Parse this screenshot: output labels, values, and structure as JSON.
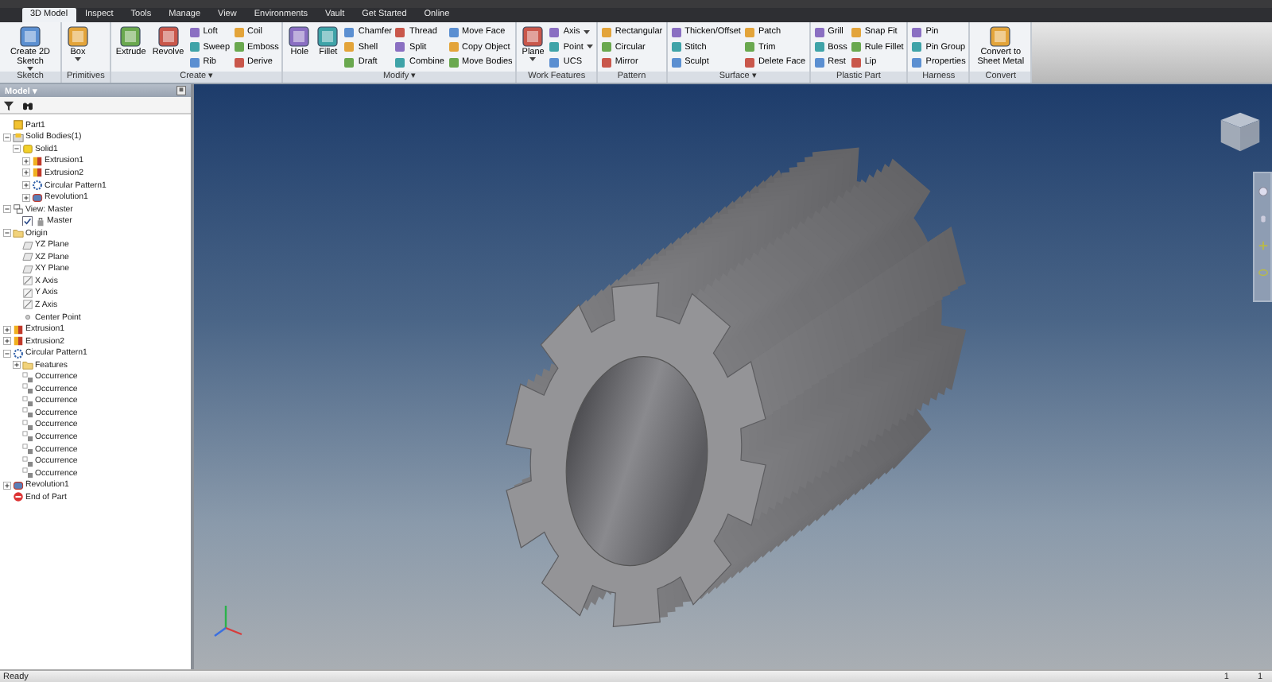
{
  "tabs": [
    {
      "label": "3D Model",
      "selected": true
    },
    {
      "label": "Inspect",
      "selected": false
    },
    {
      "label": "Tools",
      "selected": false
    },
    {
      "label": "Manage",
      "selected": false
    },
    {
      "label": "View",
      "selected": false
    },
    {
      "label": "Environments",
      "selected": false
    },
    {
      "label": "Vault",
      "selected": false
    },
    {
      "label": "Get Started",
      "selected": false
    },
    {
      "label": "Online",
      "selected": false
    }
  ],
  "ribbon": [
    {
      "title": "Sketch",
      "columns": [
        {
          "kind": "large",
          "items": [
            {
              "label": "Create 2D Sketch",
              "menu": true
            }
          ]
        }
      ]
    },
    {
      "title": "Primitives",
      "columns": [
        {
          "kind": "large",
          "items": [
            {
              "label": "Box",
              "menu": true
            }
          ]
        }
      ]
    },
    {
      "title": "Create ▾",
      "columns": [
        {
          "kind": "large",
          "items": [
            {
              "label": "Extrude",
              "menu": false
            }
          ]
        },
        {
          "kind": "large",
          "items": [
            {
              "label": "Revolve",
              "menu": false
            }
          ]
        },
        {
          "kind": "small",
          "items": [
            {
              "label": "Loft",
              "menu": false
            },
            {
              "label": "Sweep",
              "menu": false
            },
            {
              "label": "Rib",
              "menu": false
            }
          ]
        },
        {
          "kind": "small",
          "items": [
            {
              "label": "Coil",
              "menu": false
            },
            {
              "label": "Emboss",
              "menu": false
            },
            {
              "label": "Derive",
              "menu": false
            }
          ]
        }
      ]
    },
    {
      "title": "Modify ▾",
      "columns": [
        {
          "kind": "large",
          "items": [
            {
              "label": "Hole",
              "menu": false
            }
          ]
        },
        {
          "kind": "large",
          "items": [
            {
              "label": "Fillet",
              "menu": false
            }
          ]
        },
        {
          "kind": "small",
          "items": [
            {
              "label": "Chamfer",
              "menu": false
            },
            {
              "label": "Shell",
              "menu": false
            },
            {
              "label": "Draft",
              "menu": false
            }
          ]
        },
        {
          "kind": "small",
          "items": [
            {
              "label": "Thread",
              "menu": false
            },
            {
              "label": "Split",
              "menu": false
            },
            {
              "label": "Combine",
              "menu": false
            }
          ]
        },
        {
          "kind": "small",
          "items": [
            {
              "label": "Move Face",
              "menu": false
            },
            {
              "label": "Copy Object",
              "menu": false
            },
            {
              "label": "Move Bodies",
              "menu": false
            }
          ]
        }
      ]
    },
    {
      "title": "Work Features",
      "columns": [
        {
          "kind": "large",
          "items": [
            {
              "label": "Plane",
              "menu": true
            }
          ]
        },
        {
          "kind": "small",
          "items": [
            {
              "label": "Axis",
              "menu": true
            },
            {
              "label": "Point",
              "menu": true
            },
            {
              "label": "UCS",
              "menu": false
            }
          ]
        }
      ]
    },
    {
      "title": "Pattern",
      "columns": [
        {
          "kind": "small",
          "items": [
            {
              "label": "Rectangular",
              "menu": false
            },
            {
              "label": "Circular",
              "menu": false
            },
            {
              "label": "Mirror",
              "menu": false
            }
          ]
        }
      ]
    },
    {
      "title": "Surface ▾",
      "columns": [
        {
          "kind": "small",
          "items": [
            {
              "label": "Thicken/Offset",
              "menu": false
            },
            {
              "label": "Stitch",
              "menu": false
            },
            {
              "label": "Sculpt",
              "menu": false
            }
          ]
        },
        {
          "kind": "small",
          "items": [
            {
              "label": "Patch",
              "menu": false
            },
            {
              "label": "Trim",
              "menu": false
            },
            {
              "label": "Delete Face",
              "menu": false
            }
          ]
        }
      ]
    },
    {
      "title": "Plastic Part",
      "columns": [
        {
          "kind": "small",
          "items": [
            {
              "label": "Grill",
              "menu": false
            },
            {
              "label": "Boss",
              "menu": false
            },
            {
              "label": "Rest",
              "menu": false
            }
          ]
        },
        {
          "kind": "small",
          "items": [
            {
              "label": "Snap Fit",
              "menu": false
            },
            {
              "label": "Rule Fillet",
              "menu": false
            },
            {
              "label": "Lip",
              "menu": false
            }
          ]
        }
      ]
    },
    {
      "title": "Harness",
      "columns": [
        {
          "kind": "small",
          "items": [
            {
              "label": "Pin",
              "menu": false
            },
            {
              "label": "Pin Group",
              "menu": false
            },
            {
              "label": "Properties",
              "menu": false
            }
          ]
        }
      ]
    },
    {
      "title": "Convert",
      "columns": [
        {
          "kind": "large",
          "items": [
            {
              "label": "Convert to Sheet Metal",
              "menu": false
            }
          ]
        }
      ]
    }
  ],
  "browser": {
    "title": "Model ▾",
    "tree": [
      {
        "label": "Part1",
        "kind": "part"
      },
      {
        "label": "Solid Bodies(1)",
        "kind": "bodies",
        "expanded": true,
        "children": [
          {
            "label": "Solid1",
            "kind": "body",
            "expanded": true,
            "children": [
              {
                "label": "Extrusion1",
                "kind": "feature",
                "expanded": false
              },
              {
                "label": "Extrusion2",
                "kind": "feature",
                "expanded": false
              },
              {
                "label": "Circular Pattern1",
                "kind": "pattern",
                "expanded": false
              },
              {
                "label": "Revolution1",
                "kind": "revolution",
                "expanded": false
              }
            ]
          }
        ]
      },
      {
        "label": "View: Master",
        "kind": "view",
        "expanded": true,
        "children": [
          {
            "label": "Master",
            "kind": "rep",
            "checked": true
          }
        ]
      },
      {
        "label": "Origin",
        "kind": "folder",
        "expanded": true,
        "children": [
          {
            "label": "YZ Plane",
            "kind": "plane"
          },
          {
            "label": "XZ Plane",
            "kind": "plane"
          },
          {
            "label": "XY Plane",
            "kind": "plane"
          },
          {
            "label": "X Axis",
            "kind": "axis"
          },
          {
            "label": "Y Axis",
            "kind": "axis"
          },
          {
            "label": "Z Axis",
            "kind": "axis"
          },
          {
            "label": "Center Point",
            "kind": "point"
          }
        ]
      },
      {
        "label": "Extrusion1",
        "kind": "feature",
        "expanded": false
      },
      {
        "label": "Extrusion2",
        "kind": "feature",
        "expanded": false
      },
      {
        "label": "Circular Pattern1",
        "kind": "pattern",
        "expanded": true,
        "children": [
          {
            "label": "Features",
            "kind": "folder",
            "expanded": false
          },
          {
            "label": "Occurrence",
            "kind": "occurrence"
          },
          {
            "label": "Occurrence",
            "kind": "occurrence"
          },
          {
            "label": "Occurrence",
            "kind": "occurrence"
          },
          {
            "label": "Occurrence",
            "kind": "occurrence"
          },
          {
            "label": "Occurrence",
            "kind": "occurrence"
          },
          {
            "label": "Occurrence",
            "kind": "occurrence"
          },
          {
            "label": "Occurrence",
            "kind": "occurrence"
          },
          {
            "label": "Occurrence",
            "kind": "occurrence"
          },
          {
            "label": "Occurrence",
            "kind": "occurrence"
          }
        ]
      },
      {
        "label": "Revolution1",
        "kind": "revolution",
        "expanded": false
      },
      {
        "label": "End of Part",
        "kind": "end"
      }
    ]
  },
  "status_bar": {
    "text": "Ready",
    "counters": [
      "1",
      "1"
    ]
  }
}
